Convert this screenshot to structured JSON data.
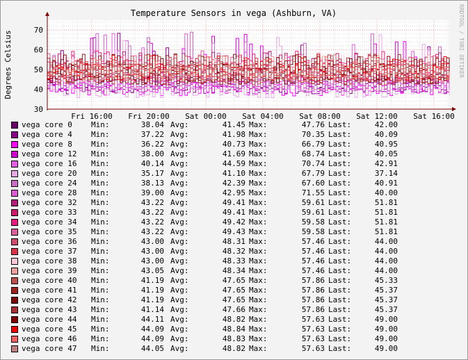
{
  "colors": {
    "background": "#f3f3f3",
    "plot": "#ffffff",
    "grid_major": "#ff9c9c",
    "grid_minor": "#dddddd",
    "axis": "#7f0000"
  },
  "labels": {
    "min": "Min:",
    "avg": "Avg:",
    "max": "Max:",
    "last": "Last:"
  },
  "chart_data": {
    "type": "line",
    "title": "Temperature Sensors in vega (Ashburn, VA)",
    "ylabel": "Degrees Celsius",
    "watermark": "RRDTOOL / TOBI OETIKER",
    "ylim": [
      30,
      75
    ],
    "yticks": [
      30,
      40,
      50,
      60,
      70
    ],
    "xticks": [
      "Fri 16:00",
      "Fri 20:00",
      "Sat 00:00",
      "Sat 04:00",
      "Sat 08:00",
      "Sat 12:00",
      "Sat 16:00"
    ],
    "grid": true,
    "legend_position": "bottom",
    "series": [
      {
        "name": "vega core 0",
        "color": "#6b006b",
        "min": "38.04",
        "avg": "41.45",
        "max": "47.76",
        "last": "42.00"
      },
      {
        "name": "vega core 4",
        "color": "#8b008b",
        "min": "37.22",
        "avg": "41.98",
        "max": "70.35",
        "last": "40.09"
      },
      {
        "name": "vega core 8",
        "color": "#ff00ff",
        "min": "36.22",
        "avg": "40.73",
        "max": "66.79",
        "last": "40.95"
      },
      {
        "name": "vega core 12",
        "color": "#d400d4",
        "min": "38.00",
        "avg": "41.69",
        "max": "68.74",
        "last": "40.05"
      },
      {
        "name": "vega core 16",
        "color": "#e65ce6",
        "min": "40.14",
        "avg": "44.59",
        "max": "70.74",
        "last": "42.91"
      },
      {
        "name": "vega core 20",
        "color": "#e8a8e8",
        "min": "35.17",
        "avg": "41.10",
        "max": "67.79",
        "last": "37.14"
      },
      {
        "name": "vega core 24",
        "color": "#c86ec8",
        "min": "38.13",
        "avg": "42.39",
        "max": "67.60",
        "last": "40.91"
      },
      {
        "name": "vega core 28",
        "color": "#db5cd2",
        "min": "39.00",
        "avg": "42.95",
        "max": "71.55",
        "last": "40.00"
      },
      {
        "name": "vega core 32",
        "color": "#b0207a",
        "min": "43.22",
        "avg": "49.41",
        "max": "59.61",
        "last": "51.81"
      },
      {
        "name": "vega core 33",
        "color": "#d0186e",
        "min": "43.22",
        "avg": "49.41",
        "max": "59.61",
        "last": "51.81"
      },
      {
        "name": "vega core 34",
        "color": "#f01880",
        "min": "43.22",
        "avg": "49.42",
        "max": "59.58",
        "last": "51.81"
      },
      {
        "name": "vega core 35",
        "color": "#e05c9c",
        "min": "43.22",
        "avg": "49.43",
        "max": "59.58",
        "last": "51.81"
      },
      {
        "name": "vega core 36",
        "color": "#d04a6e",
        "min": "43.00",
        "avg": "48.31",
        "max": "57.46",
        "last": "44.00"
      },
      {
        "name": "vega core 37",
        "color": "#e0304a",
        "min": "43.00",
        "avg": "48.32",
        "max": "57.46",
        "last": "44.00"
      },
      {
        "name": "vega core 38",
        "color": "#ffc8d8",
        "min": "43.00",
        "avg": "48.33",
        "max": "57.46",
        "last": "44.00"
      },
      {
        "name": "vega core 39",
        "color": "#f0a0a0",
        "min": "43.05",
        "avg": "48.34",
        "max": "57.46",
        "last": "44.00"
      },
      {
        "name": "vega core 40",
        "color": "#c05050",
        "min": "41.19",
        "avg": "47.65",
        "max": "57.86",
        "last": "45.33"
      },
      {
        "name": "vega core 41",
        "color": "#a02020",
        "min": "41.19",
        "avg": "47.65",
        "max": "57.86",
        "last": "45.37"
      },
      {
        "name": "vega core 42",
        "color": "#7a0a0a",
        "min": "41.19",
        "avg": "47.65",
        "max": "57.86",
        "last": "45.37"
      },
      {
        "name": "vega core 43",
        "color": "#a83030",
        "min": "41.14",
        "avg": "47.66",
        "max": "57.86",
        "last": "45.37"
      },
      {
        "name": "vega core 44",
        "color": "#800000",
        "min": "44.11",
        "avg": "48.82",
        "max": "57.63",
        "last": "49.00"
      },
      {
        "name": "vega core 45",
        "color": "#f00000",
        "min": "44.09",
        "avg": "48.84",
        "max": "57.63",
        "last": "49.00"
      },
      {
        "name": "vega core 46",
        "color": "#f06060",
        "min": "44.09",
        "avg": "48.83",
        "max": "57.63",
        "last": "49.00"
      },
      {
        "name": "vega core 47",
        "color": "#c08080",
        "min": "44.05",
        "avg": "48.82",
        "max": "57.63",
        "last": "49.00"
      }
    ]
  }
}
